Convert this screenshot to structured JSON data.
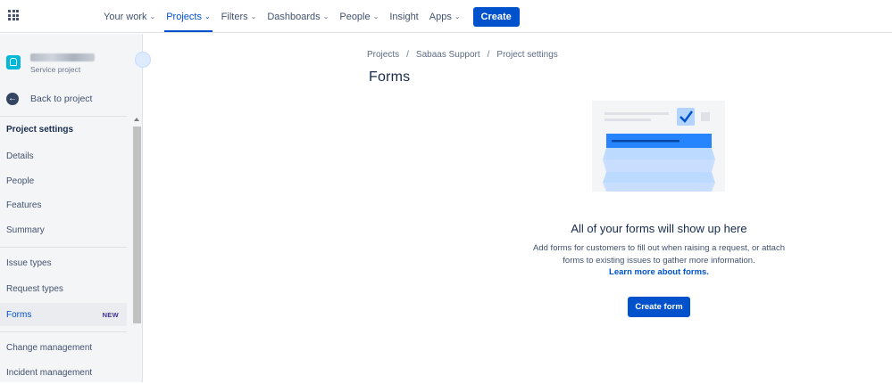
{
  "topbar": {
    "nav": [
      {
        "label": "Your work",
        "dropdown": true,
        "active": false
      },
      {
        "label": "Projects",
        "dropdown": true,
        "active": true
      },
      {
        "label": "Filters",
        "dropdown": true,
        "active": false
      },
      {
        "label": "Dashboards",
        "dropdown": true,
        "active": false
      },
      {
        "label": "People",
        "dropdown": true,
        "active": false
      },
      {
        "label": "Insight",
        "dropdown": false,
        "active": false
      },
      {
        "label": "Apps",
        "dropdown": true,
        "active": false
      }
    ],
    "create_label": "Create",
    "accent_color": "#0052CC"
  },
  "sidebar": {
    "project_type": "Service project",
    "back_label": "Back to project",
    "section_title": "Project settings",
    "group1": [
      "Details",
      "People",
      "Features",
      "Summary"
    ],
    "group2": [
      "Issue types",
      "Request types",
      "Forms"
    ],
    "forms_badge": "NEW",
    "group3": [
      "Change management",
      "Incident management"
    ],
    "selected_item": "Forms"
  },
  "breadcrumb": [
    "Projects",
    "Sabaas Support",
    "Project settings"
  ],
  "page": {
    "title": "Forms"
  },
  "empty_state": {
    "title": "All of your forms will show up here",
    "description_line1": "Add forms for customers to fill out when raising a request, or attach",
    "description_line2": "forms to existing issues to gather more information.",
    "link": "Learn more about forms.",
    "button": "Create form"
  }
}
